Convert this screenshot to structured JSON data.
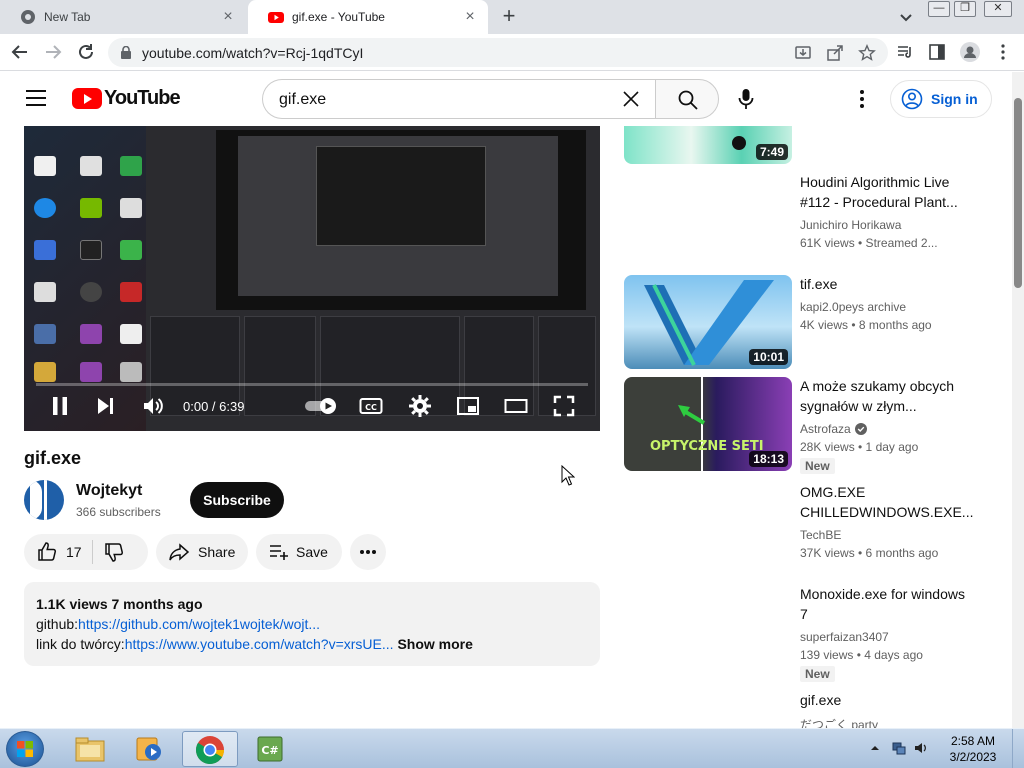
{
  "browser": {
    "tabs": [
      {
        "title": "New Tab",
        "icon": "chrome-icon",
        "active": false
      },
      {
        "title": "gif.exe - YouTube",
        "icon": "youtube-icon",
        "active": true
      }
    ],
    "new_tab_label": "+",
    "url": "youtube.com/watch?v=Rcj-1qdTCyI"
  },
  "youtube": {
    "logo_text": "YouTube",
    "search_query": "gif.exe",
    "sign_in_label": "Sign in"
  },
  "player": {
    "time": "0:00 / 6:39",
    "progress": 0.0
  },
  "video": {
    "title": "gif.exe",
    "channel": "Wojtekyt",
    "subscribers": "366 subscribers",
    "subscribe_label": "Subscribe",
    "likes": "17",
    "share_label": "Share",
    "save_label": "Save",
    "more_label": "...",
    "description": {
      "meta": "1.1K views  7 months ago",
      "line1_prefix": "github:",
      "line1_link": "https://github.com/wojtek1wojtek/wojt...",
      "line2_prefix": "link do twórcy:",
      "line2_link": "https://www.youtube.com/watch?v=xrsUE...",
      "show_more": "Show more"
    }
  },
  "recommendations": [
    {
      "title": "",
      "channel": "",
      "meta": "",
      "duration": "7:49",
      "badge": ""
    },
    {
      "title": "Houdini Algorithmic Live #112 - Procedural Plant...",
      "channel": "Junichiro Horikawa",
      "meta": "61K views  • Streamed 2...",
      "duration": "",
      "badge": ""
    },
    {
      "title": "tif.exe",
      "channel": "kapi2.0peys archive",
      "meta": "4K views  • 8 months ago",
      "duration": "10:01",
      "badge": ""
    },
    {
      "title": "A może szukamy obcych sygnałów w złym...",
      "channel": "Astrofaza",
      "meta": "28K views  • 1 day ago",
      "duration": "18:13",
      "badge": "New",
      "thumb_text": "OPTYCZNE SETI"
    },
    {
      "title": "OMG.EXE CHILLEDWINDOWS.EXE...",
      "channel": "TechBE",
      "meta": "37K views  • 6 months ago",
      "duration": "",
      "badge": ""
    },
    {
      "title": "Monoxide.exe for windows 7",
      "channel": "superfaizan3407",
      "meta": "139 views  • 4 days ago",
      "duration": "",
      "badge": "New"
    },
    {
      "title": "gif.exe",
      "channel": "だつごく party",
      "meta": "",
      "duration": "",
      "badge": ""
    }
  ],
  "taskbar": {
    "time": "2:58 AM",
    "date": "3/2/2023"
  },
  "colors": {
    "youtube_red": "#ff0000",
    "link_blue": "#065fd4",
    "chrome_tabstrip": "#dee1e6",
    "win7_taskbar": "#b9cde6"
  }
}
